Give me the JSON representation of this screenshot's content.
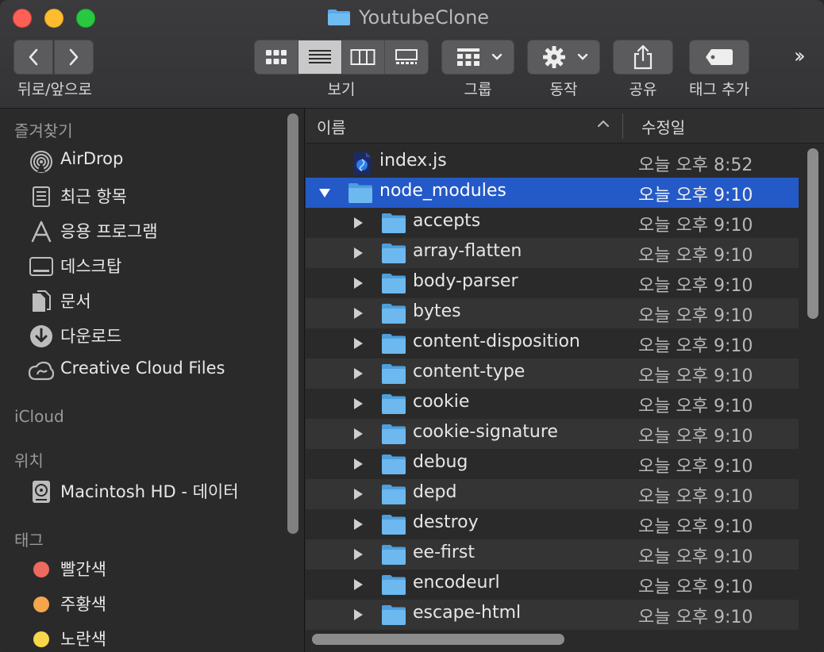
{
  "window": {
    "title": "YoutubeClone"
  },
  "toolbar": {
    "nav_label": "뒤로/앞으로",
    "view_label": "보기",
    "group_label": "그룹",
    "action_label": "동작",
    "share_label": "공유",
    "tag_label": "태그 추가",
    "active_view": "list"
  },
  "sidebar": {
    "favorites_heading": "즐겨찾기",
    "favorites": [
      {
        "label": "AirDrop",
        "icon": "airdrop-icon"
      },
      {
        "label": "최근 항목",
        "icon": "recents-icon"
      },
      {
        "label": "응용 프로그램",
        "icon": "applications-icon"
      },
      {
        "label": "데스크탑",
        "icon": "desktop-icon"
      },
      {
        "label": "문서",
        "icon": "documents-icon"
      },
      {
        "label": "다운로드",
        "icon": "downloads-icon"
      },
      {
        "label": "Creative Cloud Files",
        "icon": "creative-cloud-icon"
      }
    ],
    "icloud_heading": "iCloud",
    "locations_heading": "위치",
    "locations": [
      {
        "label": "Macintosh HD - 데이터",
        "icon": "hard-drive-icon"
      }
    ],
    "tags_heading": "태그",
    "tags": [
      {
        "label": "빨간색",
        "color": "#ed6a5e"
      },
      {
        "label": "주황색",
        "color": "#f5a54a"
      },
      {
        "label": "노란색",
        "color": "#f6d84a"
      }
    ]
  },
  "list": {
    "col_name": "이름",
    "col_date": "수정일",
    "rows": [
      {
        "name": "index.js",
        "date": "오늘 오후 8:52",
        "level": 0,
        "kind": "js",
        "disclosure": "none"
      },
      {
        "name": "node_modules",
        "date": "오늘 오후 9:10",
        "level": 0,
        "kind": "folder",
        "disclosure": "open",
        "selected": true
      },
      {
        "name": "accepts",
        "date": "오늘 오후 9:10",
        "level": 1,
        "kind": "folder",
        "disclosure": "closed"
      },
      {
        "name": "array-flatten",
        "date": "오늘 오후 9:10",
        "level": 1,
        "kind": "folder",
        "disclosure": "closed"
      },
      {
        "name": "body-parser",
        "date": "오늘 오후 9:10",
        "level": 1,
        "kind": "folder",
        "disclosure": "closed"
      },
      {
        "name": "bytes",
        "date": "오늘 오후 9:10",
        "level": 1,
        "kind": "folder",
        "disclosure": "closed"
      },
      {
        "name": "content-disposition",
        "date": "오늘 오후 9:10",
        "level": 1,
        "kind": "folder",
        "disclosure": "closed"
      },
      {
        "name": "content-type",
        "date": "오늘 오후 9:10",
        "level": 1,
        "kind": "folder",
        "disclosure": "closed"
      },
      {
        "name": "cookie",
        "date": "오늘 오후 9:10",
        "level": 1,
        "kind": "folder",
        "disclosure": "closed"
      },
      {
        "name": "cookie-signature",
        "date": "오늘 오후 9:10",
        "level": 1,
        "kind": "folder",
        "disclosure": "closed"
      },
      {
        "name": "debug",
        "date": "오늘 오후 9:10",
        "level": 1,
        "kind": "folder",
        "disclosure": "closed"
      },
      {
        "name": "depd",
        "date": "오늘 오후 9:10",
        "level": 1,
        "kind": "folder",
        "disclosure": "closed"
      },
      {
        "name": "destroy",
        "date": "오늘 오후 9:10",
        "level": 1,
        "kind": "folder",
        "disclosure": "closed"
      },
      {
        "name": "ee-first",
        "date": "오늘 오후 9:10",
        "level": 1,
        "kind": "folder",
        "disclosure": "closed"
      },
      {
        "name": "encodeurl",
        "date": "오늘 오후 9:10",
        "level": 1,
        "kind": "folder",
        "disclosure": "closed"
      },
      {
        "name": "escape-html",
        "date": "오늘 오후 9:10",
        "level": 1,
        "kind": "folder",
        "disclosure": "closed"
      }
    ]
  }
}
